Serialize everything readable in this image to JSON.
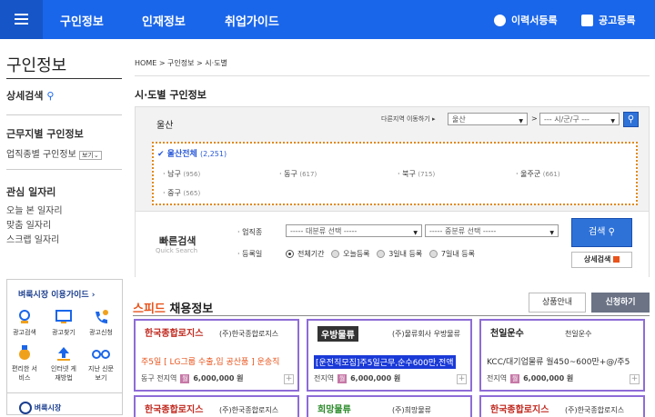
{
  "topnav": {
    "items": [
      "구인정보",
      "인재정보",
      "취업가이드"
    ],
    "resume": "이력서등록",
    "jobpost": "공고등록"
  },
  "sidebar": {
    "title": "구인정보",
    "detail_search": "상세검색",
    "work_area": "근무지별 구인정보",
    "industry": "업직종별 구인정보",
    "view_label": "보기",
    "interest_title": "관심 일자리",
    "interest_items": [
      "오늘 본 일자리",
      "맞춤 일자리",
      "스크랩 일자리"
    ],
    "guide_title": "벼룩시장 이용가이드",
    "guide_icons": [
      "광고검색",
      "광고찾기",
      "광고신청",
      "편리한 서비스",
      "인터넷 게재방법",
      "지난 신문보기"
    ],
    "brand_footer": "벼룩시장"
  },
  "breadcrumb": "HOME > 구인정보 > 시·도별",
  "main": {
    "section_title": "시·도별 구인정보",
    "region_name": "울산",
    "other_region_label": "다른지역 이동하기",
    "select_region": "울산",
    "select_sub": "--- 시/군/구 ---",
    "all_region": "울산전체",
    "all_count": "(2,251)",
    "districts": [
      {
        "name": "남구",
        "count": "(956)"
      },
      {
        "name": "동구",
        "count": "(617)"
      },
      {
        "name": "북구",
        "count": "(715)"
      },
      {
        "name": "울주군",
        "count": "(661)"
      },
      {
        "name": "중구",
        "count": "(565)"
      }
    ],
    "quick": {
      "title": "빠른검색",
      "subtitle": "Quick Search",
      "industry_label": "업직종",
      "cat_main": "----- 대분류 선택 -----",
      "cat_sub": "----- 중분류 선택 -----",
      "date_label": "등록일",
      "periods": [
        "전체기간",
        "오늘등록",
        "3일내 등록",
        "7일내 등록"
      ],
      "search_button": "검색",
      "detail_button": "상세검색"
    },
    "speed": {
      "title_a": "스피드",
      "title_b": " 채용정보",
      "product_info": "상품안내",
      "apply": "신청하기"
    },
    "cards": [
      {
        "logo": "한국종합로지스",
        "company": "(주)한국종합로지스",
        "title": "주5일 [ LG그룹 수출,입 공산품 ] 운송직",
        "meta": "동구 전지역",
        "pay": "6,000,000 원"
      },
      {
        "logo": "우방물류",
        "company": "(주)물류회사 우방물류",
        "title": "[운전직모집]주5일근무,순수600만,전액",
        "meta": "전지역",
        "pay": "6,000,000 원"
      },
      {
        "logo": "천일운수",
        "company": "천일운수",
        "title": "KCC/대기업물류 월450~600만+@/주5",
        "meta": "전지역",
        "pay": "6,000,000 원"
      },
      {
        "logo": "한국종합로지스",
        "company": "(주)한국종합로지스"
      },
      {
        "logo": "희망물류",
        "company": "(주)희망물류"
      },
      {
        "logo": "한국종합로지스",
        "company": "(주)한국종합로지스"
      }
    ]
  },
  "colors": {
    "primary": "#1a66ea",
    "accent": "#e8541c",
    "card_border": "#8e6cd6",
    "orange_dots": "#e08a1e"
  }
}
